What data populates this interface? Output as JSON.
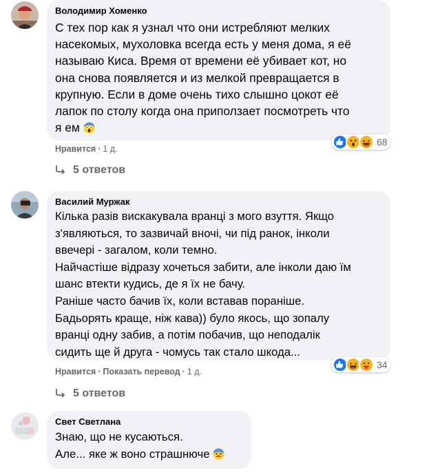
{
  "comments": [
    {
      "author": "Володимир Хоменко",
      "lines": [
        "С тех пор как я узнал что они истребляют мелких",
        "насекомых, мухоловка всегда есть у меня дома, я её",
        "называю Киса. Время от времени её убивает кот, но",
        "она снова появляется и из мелкой превращается в",
        "крупную. Если в доме очень тихо слышно цокот её",
        "лапок по столу когда она приползает посмотреть что",
        "я ем"
      ],
      "inline_emoji": "screaming-face-icon",
      "reaction_icons": [
        "like-reaction-icon",
        "wow-reaction-icon",
        "haha-reaction-icon"
      ],
      "reaction_count": "68",
      "like_label": "Нравится",
      "time": "1 д.",
      "replies_label": "5 ответов"
    },
    {
      "author": "Василий Муржак",
      "lines": [
        "Кілька разів вискакувала вранці з мого взуття. Якщо",
        "з'являються, то зазвичай вночі, чи під ранок, інколи",
        "ввечері - загалом, коли темно.",
        "Найчастіше відразу хочеться забити, але інколи даю їм",
        "шанс втекти кудись, де я їх не бачу.",
        "Раніше часто бачив їх, коли вставав пораніше.",
        "Бадьорять краще, ніж кава)) було якось, що зопалу",
        "вранці одну забив, а потім побачив, що неподалік",
        "сидить ще й друга - чомусь так стало шкода..."
      ],
      "reaction_icons": [
        "like-reaction-icon",
        "haha-reaction-icon",
        "care-reaction-icon"
      ],
      "reaction_count": "34",
      "like_label": "Нравится",
      "translate_label": "Показать перевод",
      "time": "1 д.",
      "replies_label": "5 ответов"
    },
    {
      "author": "Свет Светлана",
      "lines": [
        "Знаю, що не кусаються.",
        "Але... яке ж воно страшнюче"
      ],
      "inline_emoji": "fearful-face-icon"
    }
  ],
  "colors": {
    "bubble": "#f0f2f5",
    "meta": "#65676b",
    "text": "#050505",
    "like_blue": "#1877f2"
  }
}
